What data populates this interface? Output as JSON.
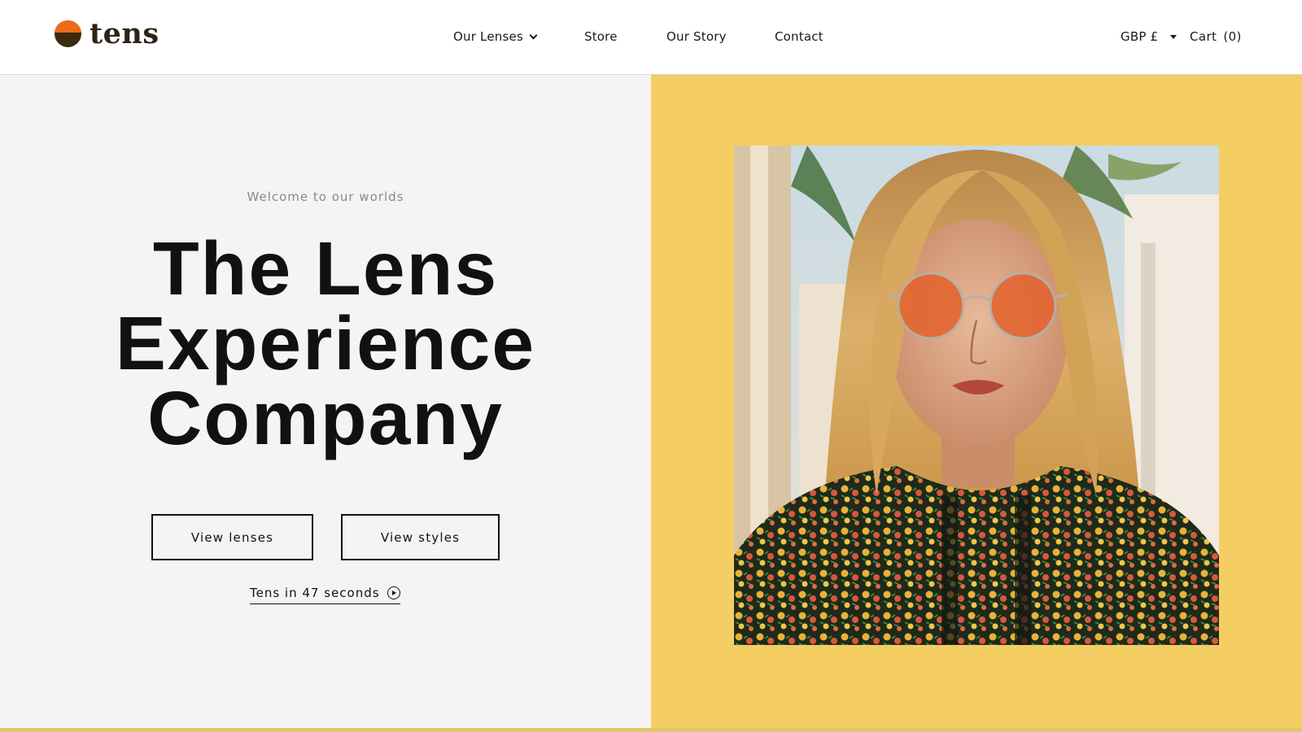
{
  "header": {
    "logo_text": "tens",
    "logo_colors": {
      "top": "#ef6a1c",
      "bottom": "#3a2a10"
    },
    "nav": [
      {
        "label": "Our Lenses",
        "has_dropdown": true
      },
      {
        "label": "Store"
      },
      {
        "label": "Our Story"
      },
      {
        "label": "Contact"
      }
    ],
    "currency": "GBP £",
    "cart_label": "Cart",
    "cart_count": "(0)"
  },
  "hero": {
    "eyebrow": "Welcome to our worlds",
    "headline": [
      "The Lens",
      "Experience",
      "Company"
    ],
    "buttons": {
      "lenses": "View lenses",
      "styles": "View styles"
    },
    "video_link": "Tens in 47 seconds",
    "colors": {
      "left_bg": "#f5f4f2",
      "right_bg": "#f4cd63"
    }
  },
  "icons": {
    "dropdown": "chevron-down-icon",
    "currency": "caret-down-icon",
    "video": "play-circle-icon"
  }
}
